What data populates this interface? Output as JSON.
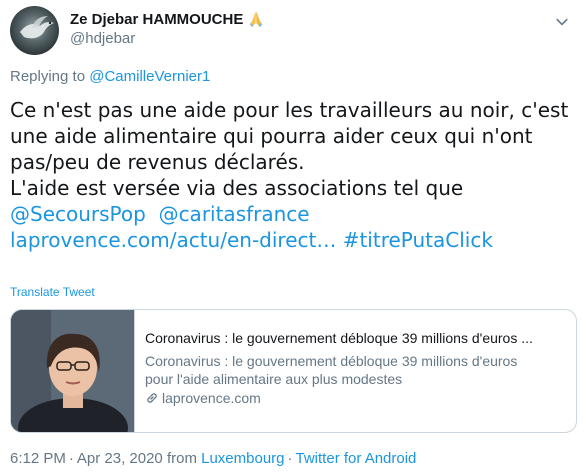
{
  "author": {
    "display_name": "Ze Djebar HAMMOUCHE",
    "handle": "@hdjebar",
    "name_emoji_icon": "folded-hands-icon"
  },
  "reply": {
    "prefix": "Replying to",
    "mention": "@CamilleVernier1"
  },
  "tweet": {
    "line1": "Ce n'est pas une aide pour les travailleurs au noir, c'est",
    "line2": "une aide alimentaire qui pourra aider ceux qui n'ont",
    "line3": "pas/peu de revenus déclarés.",
    "line4": "L'aide est versée via des associations tel que",
    "mention1": "@SecoursPop",
    "mention2": "@caritasfrance",
    "url": "laprovence.com/actu/en-direct…",
    "hashtag": "#titrePutaClick"
  },
  "translate_label": "Translate Tweet",
  "card": {
    "title": "Coronavirus : le gouvernement débloque 39 millions d'euros ...",
    "description_line1": "Coronavirus : le gouvernement débloque 39 millions d'euros",
    "description_line2": "pour l'aide alimentaire aux plus modestes",
    "domain": "laprovence.com"
  },
  "meta": {
    "time": "6:12 PM",
    "date": "Apr 23, 2020",
    "from_label": "from",
    "location": "Luxembourg",
    "source": "Twitter for Android",
    "separator": "·"
  },
  "colors": {
    "link": "#1b95e0",
    "secondary_text": "#657786",
    "primary_text": "#14171a",
    "border": "#ccd6dd"
  }
}
